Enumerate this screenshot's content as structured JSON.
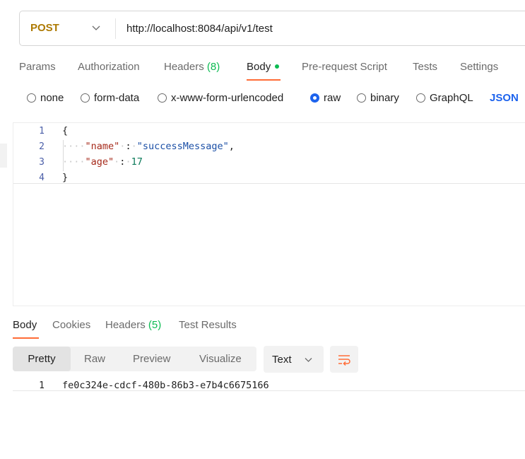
{
  "request": {
    "method": "POST",
    "url": "http://localhost:8084/api/v1/test"
  },
  "request_tabs": {
    "params": "Params",
    "authorization": "Authorization",
    "headers_label": "Headers",
    "headers_count": "(8)",
    "body": "Body",
    "pre_request": "Pre-request Script",
    "tests": "Tests",
    "settings": "Settings"
  },
  "body_types": {
    "none": "none",
    "form_data": "form-data",
    "urlencoded": "x-www-form-urlencoded",
    "raw": "raw",
    "binary": "binary",
    "graphql": "GraphQL",
    "format": "JSON",
    "selected": "raw"
  },
  "editor": {
    "line_numbers": [
      "1",
      "2",
      "3",
      "4"
    ],
    "open_brace": "{",
    "close_brace": "}",
    "key1": "\"name\"",
    "val1": "\"successMessage\"",
    "key2": "\"age\"",
    "val2": "17"
  },
  "response_tabs": {
    "body": "Body",
    "cookies": "Cookies",
    "headers_label": "Headers",
    "headers_count": "(5)",
    "test_results": "Test Results"
  },
  "response_view": {
    "pretty": "Pretty",
    "raw": "Raw",
    "preview": "Preview",
    "visualize": "Visualize",
    "format": "Text"
  },
  "response_body": {
    "line_number": "1",
    "content": "fe0c324e-cdcf-480b-86b3-e7b4c6675166"
  },
  "colors": {
    "method": "#ad7a03",
    "accent_underline": "#ff6c37",
    "link_blue": "#1d63ed",
    "count_green": "#0cbb52"
  }
}
